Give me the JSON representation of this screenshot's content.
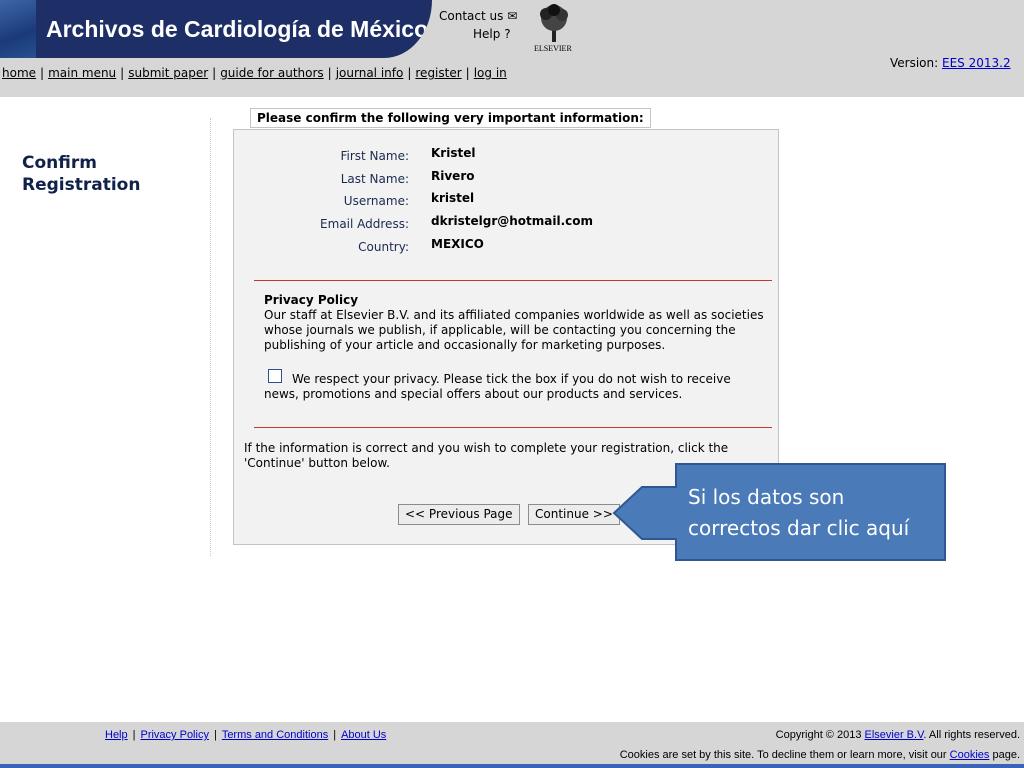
{
  "header": {
    "title": "Archivos de Cardiología de México",
    "contact_label": "Contact us",
    "help_label": "Help",
    "publisher": "ELSEVIER",
    "brand_color": "#1d2f66"
  },
  "nav": [
    "home",
    "main menu",
    "submit paper",
    "guide for authors",
    "journal info",
    "register",
    "log in"
  ],
  "version": {
    "label": "Version:",
    "value": "EES 2013.2"
  },
  "page": {
    "heading_line1": "Confirm",
    "heading_line2": "Registration"
  },
  "form": {
    "title": "Please confirm the following very important information:",
    "fields": [
      {
        "label": "First Name:",
        "value": "Kristel"
      },
      {
        "label": "Last Name:",
        "value": "Rivero"
      },
      {
        "label": "Username:",
        "value": "kristel"
      },
      {
        "label": "Email Address:",
        "value": "dkristelgr@hotmail.com"
      },
      {
        "label": "Country:",
        "value": "MEXICO"
      }
    ],
    "privacy_title": "Privacy Policy",
    "privacy_text": "Our staff at Elsevier B.V. and its affiliated companies worldwide as well as societies whose journals we publish, if applicable, will be contacting you concerning the publishing of your article and occasionally for marketing purposes.",
    "optout_text": "We respect your privacy. Please tick the box if you do not wish to receive news, promotions and special offers about our products and services.",
    "optout_checked": false,
    "instruction": "If the information is correct and you wish to complete your registration, click the 'Continue' button below.",
    "prev_button": "<< Previous Page",
    "continue_button": "Continue >>"
  },
  "callout": {
    "text": "Si los datos son correctos dar clic aquí",
    "color": "#4a7ab8"
  },
  "footer": {
    "links": [
      "Help",
      "Privacy Policy",
      "Terms and Conditions",
      "About Us"
    ],
    "copyright_prefix": "Copyright © 2013",
    "copyright_link": "Elsevier B.V",
    "copyright_suffix": ". All rights reserved.",
    "cookies_prefix": "Cookies are set by this site. To decline them or learn more, visit our",
    "cookies_link": "Cookies",
    "cookies_suffix": "page."
  }
}
